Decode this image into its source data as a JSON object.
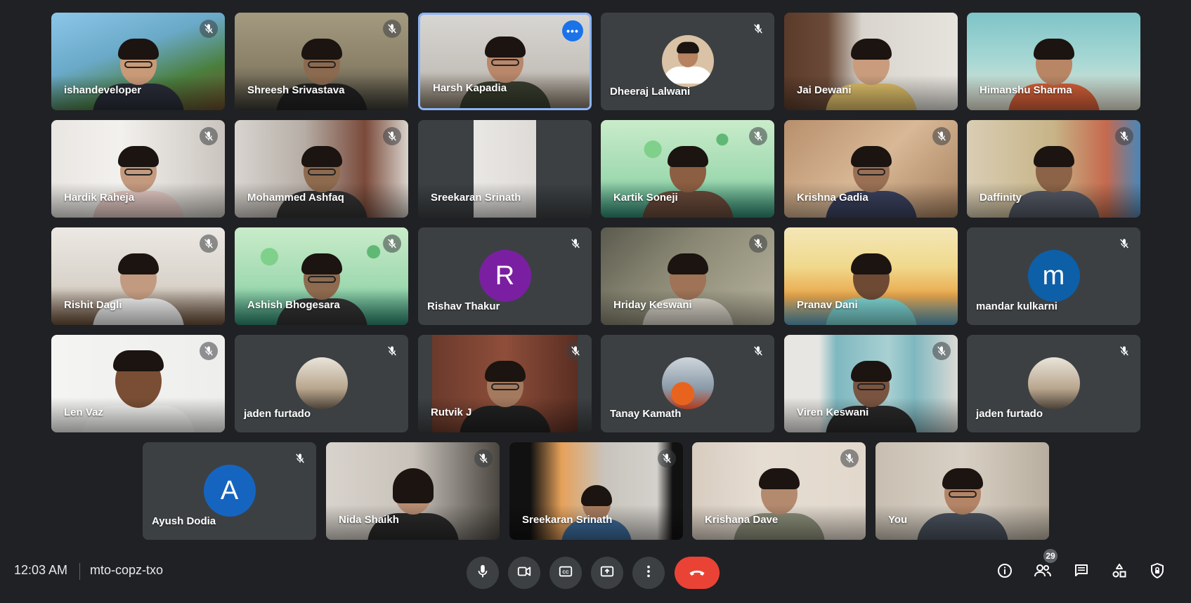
{
  "participants": [
    {
      "name": "ishandeveloper",
      "muted": true
    },
    {
      "name": "Shreesh Srivastava",
      "muted": true
    },
    {
      "name": "Harsh Kapadia",
      "muted": false,
      "active": true
    },
    {
      "name": "Dheeraj Lalwani",
      "muted": true
    },
    {
      "name": "Jai Dewani",
      "muted": false
    },
    {
      "name": "Himanshu Sharma",
      "muted": false
    },
    {
      "name": "Hardik Raheja",
      "muted": true
    },
    {
      "name": "Mohammed Ashfaq",
      "muted": true
    },
    {
      "name": "Sreekaran Srinath",
      "muted": false
    },
    {
      "name": "Kartik Soneji",
      "muted": true
    },
    {
      "name": "Krishna Gadia",
      "muted": true
    },
    {
      "name": "Daffinity",
      "muted": true
    },
    {
      "name": "Rishit Dagli",
      "muted": true
    },
    {
      "name": "Ashish Bhogesara",
      "muted": true
    },
    {
      "name": "Rishav Thakur",
      "muted": true,
      "initial": "R"
    },
    {
      "name": "Hriday Keswani",
      "muted": true
    },
    {
      "name": "Pranav Dani",
      "muted": false
    },
    {
      "name": "mandar kulkarni",
      "muted": true,
      "initial": "m"
    },
    {
      "name": "Len Vaz",
      "muted": true
    },
    {
      "name": "jaden furtado",
      "muted": true
    },
    {
      "name": "Rutvik J",
      "muted": true
    },
    {
      "name": "Tanay Kamath",
      "muted": true
    },
    {
      "name": "Viren Keswani",
      "muted": true
    },
    {
      "name": "jaden furtado",
      "muted": true
    },
    {
      "name": "Ayush Dodia",
      "muted": true,
      "initial": "A"
    },
    {
      "name": "Nida Shaikh",
      "muted": true
    },
    {
      "name": "Sreekaran Srinath",
      "muted": true
    },
    {
      "name": "Krishana Dave",
      "muted": true
    },
    {
      "name": "You",
      "muted": false
    }
  ],
  "meeting": {
    "time": "12:03 AM",
    "code": "mto-copz-txo",
    "participant_count": "29"
  },
  "controls": [
    "microphone-icon",
    "camera-icon",
    "captions-icon",
    "present-icon",
    "more-options-icon",
    "end-call-icon"
  ],
  "right_icons": [
    "info-icon",
    "people-icon",
    "chat-icon",
    "activities-icon",
    "host-controls-icon"
  ],
  "colors": {
    "background": "#202124",
    "tile": "#3c4043",
    "active_border": "#8ab4f8",
    "end_call": "#ea4335",
    "avatar_R": "#7b1fa2",
    "avatar_m": "#0d5fa8",
    "avatar_A": "#1565c0"
  }
}
